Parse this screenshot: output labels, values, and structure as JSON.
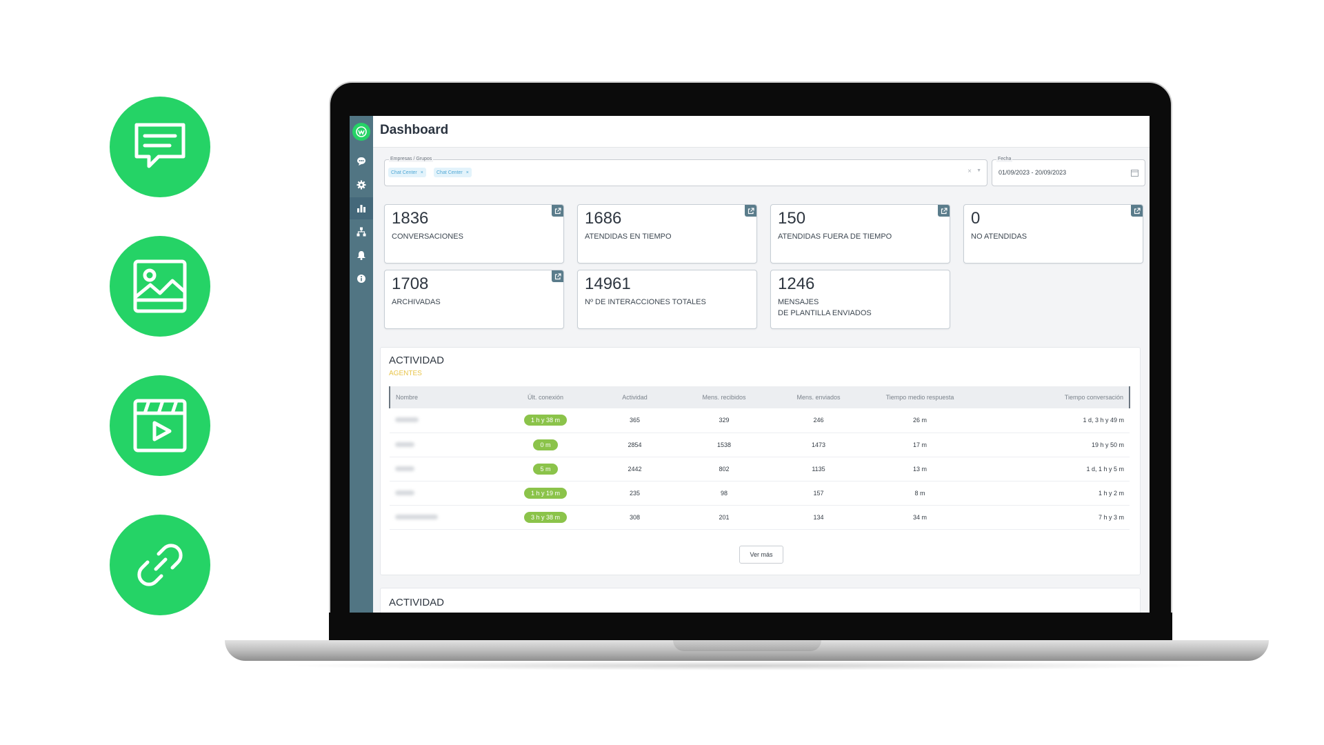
{
  "features": [
    {
      "icon": "chat-bubble-icon"
    },
    {
      "icon": "image-icon"
    },
    {
      "icon": "video-icon"
    },
    {
      "icon": "link-icon"
    }
  ],
  "colors": {
    "brand": "#25d366",
    "sidebar": "#517583",
    "pill": "#8bc34a",
    "accent_sub": "#e8c44a"
  },
  "header": {
    "title": "Dashboard"
  },
  "sidebar": {
    "items": [
      {
        "icon": "chat-icon"
      },
      {
        "icon": "gear-icon"
      },
      {
        "icon": "bar-chart-icon",
        "active": true
      },
      {
        "icon": "org-chart-icon"
      },
      {
        "icon": "bell-icon"
      },
      {
        "icon": "info-icon"
      }
    ]
  },
  "filters": {
    "companies_label": "Empresas / Grupos",
    "chips": [
      "Chat Center",
      "Chat Center"
    ],
    "date_label": "Fecha",
    "date_value": "01/09/2023 - 20/09/2023"
  },
  "stats": [
    {
      "value": "1836",
      "label": "CONVERSACIONES",
      "label2": "",
      "external": true
    },
    {
      "value": "1686",
      "label": "ATENDIDAS EN TIEMPO",
      "label2": "",
      "external": true
    },
    {
      "value": "150",
      "label": "ATENDIDAS FUERA DE TIEMPO",
      "label2": "",
      "external": true
    },
    {
      "value": "0",
      "label": "NO ATENDIDAS",
      "label2": "",
      "external": true
    },
    {
      "value": "1708",
      "label": "ARCHIVADAS",
      "label2": "",
      "external": true
    },
    {
      "value": "14961",
      "label": "Nº DE INTERACCIONES TOTALES",
      "label2": "",
      "external": false
    },
    {
      "value": "1246",
      "label": "MENSAJES",
      "label2": "DE PLANTILLA ENVIADOS",
      "external": false
    }
  ],
  "activity": {
    "title": "ACTIVIDAD",
    "subtitle": "AGENTES",
    "columns": [
      "Nombre",
      "Últ. conexión",
      "Actividad",
      "Mens. recibidos",
      "Mens. enviados",
      "Tiempo medio respuesta",
      "Tiempo conversación"
    ],
    "rows": [
      {
        "last": "1 h y 38 m",
        "activity": "365",
        "received": "329",
        "sent": "246",
        "avg": "26 m",
        "conv": "1 d, 3 h y 49 m"
      },
      {
        "last": "0 m",
        "activity": "2854",
        "received": "1538",
        "sent": "1473",
        "avg": "17 m",
        "conv": "19 h y 50 m"
      },
      {
        "last": "5 m",
        "activity": "2442",
        "received": "802",
        "sent": "1135",
        "avg": "13 m",
        "conv": "1 d, 1 h y 5 m"
      },
      {
        "last": "1 h y 19 m",
        "activity": "235",
        "received": "98",
        "sent": "157",
        "avg": "8 m",
        "conv": "1 h y 2 m"
      },
      {
        "last": "3 h y 38 m",
        "activity": "308",
        "received": "201",
        "sent": "134",
        "avg": "34 m",
        "conv": "7 h y 3 m"
      }
    ],
    "more_label": "Ver más"
  },
  "activity2": {
    "title": "ACTIVIDAD"
  }
}
